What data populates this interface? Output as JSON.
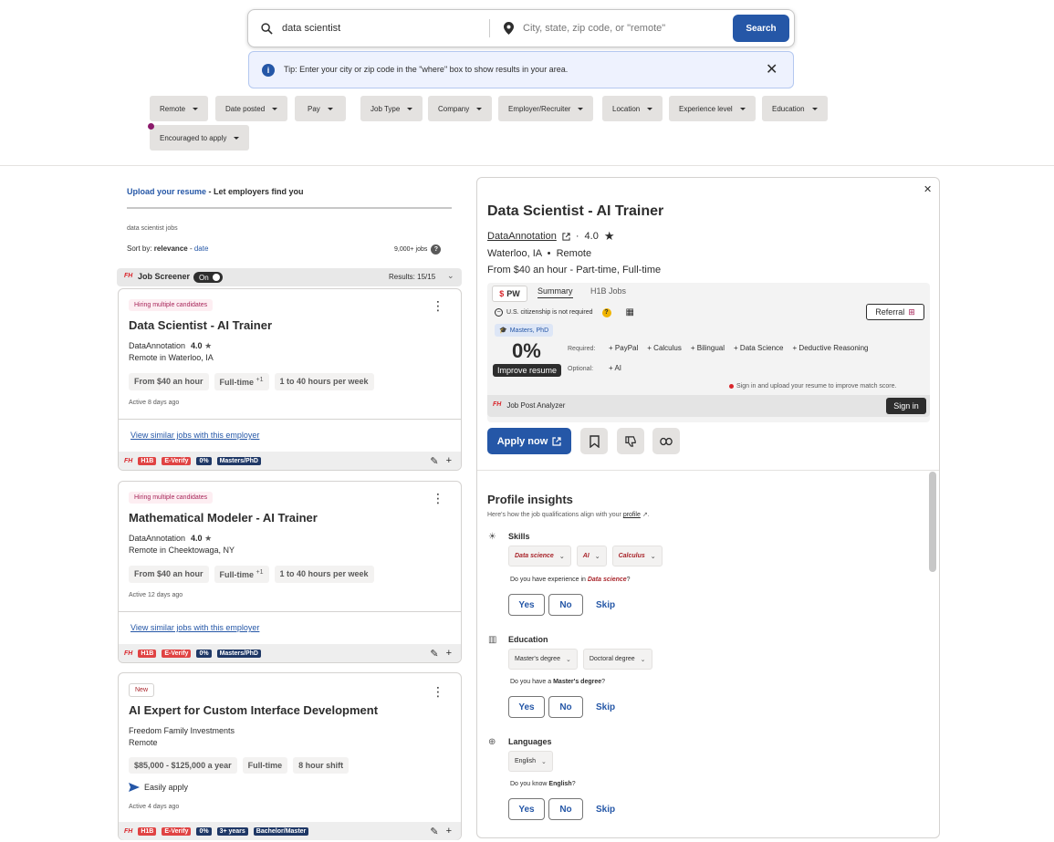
{
  "search": {
    "what_value": "data scientist",
    "where_placeholder": "City, state, zip code, or \"remote\"",
    "button_label": "Search"
  },
  "tip": {
    "text": "Tip: Enter your city or zip code in the \"where\" box to show results in your area."
  },
  "filters": [
    "Remote",
    "Date posted",
    "Pay",
    "Job Type",
    "Company",
    "Employer/Recruiter",
    "Location",
    "Experience level",
    "Education",
    "Encouraged to apply"
  ],
  "left": {
    "upload_link": "Upload your resume",
    "upload_rest": " - Let employers find you",
    "jobs_label": "data scientist jobs",
    "sort_prefix": "Sort by: ",
    "sort_active": "relevance",
    "sort_sep": " - ",
    "sort_other": "date",
    "count": "9,000+ jobs",
    "screener": {
      "fh": "FH",
      "label": "Job Screener",
      "toggle": "On",
      "results": "Results: 15/15"
    }
  },
  "cards": [
    {
      "badge": "Hiring multiple candidates",
      "title": "Data Scientist - AI Trainer",
      "company": "DataAnnotation",
      "rating": "4.0",
      "location": "Remote in Waterloo, IA",
      "chips": [
        "From $40 an hour",
        "Full-time",
        "1 to 40 hours per week"
      ],
      "chip_plus": "+1",
      "active": "Active 8 days ago",
      "similar": "View similar jobs with this employer",
      "tags": [
        "H1B",
        "E-Verify",
        "0%",
        "Masters/PhD"
      ]
    },
    {
      "badge": "Hiring multiple candidates",
      "title": "Mathematical Modeler - AI Trainer",
      "company": "DataAnnotation",
      "rating": "4.0",
      "location": "Remote in Cheektowaga, NY",
      "chips": [
        "From $40 an hour",
        "Full-time",
        "1 to 40 hours per week"
      ],
      "chip_plus": "+1",
      "active": "Active 12 days ago",
      "similar": "View similar jobs with this employer",
      "tags": [
        "H1B",
        "E-Verify",
        "0%",
        "Masters/PhD"
      ]
    },
    {
      "badge": "New",
      "title": "AI Expert for Custom Interface Development",
      "company": "Freedom Family Investments",
      "location": "Remote",
      "chips": [
        "$85,000 - $125,000 a year",
        "Full-time",
        "8 hour shift"
      ],
      "easy": "Easily apply",
      "active": "Active 4 days ago",
      "tags": [
        "H1B",
        "E-Verify",
        "0%",
        "3+ years",
        "Bachelor/Master"
      ]
    }
  ],
  "panel": {
    "title": "Data Scientist - AI Trainer",
    "company": "DataAnnotation",
    "rating": "4.0",
    "location": "Waterloo, IA",
    "remote": "Remote",
    "pay": "From $40 an hour",
    "job_type": " - Part-time, Full-time",
    "analyzer": {
      "pw": "PW",
      "tab_summary": "Summary",
      "tab_h1b": "H1B Jobs",
      "citizenship": "U.S. citizenship is not required",
      "referral": "Referral",
      "degree": "Masters, PhD",
      "score": "0%",
      "improve": "Improve resume",
      "required_label": "Required:",
      "required": [
        "PayPal",
        "Calculus",
        "Bilingual",
        "Data Science",
        "Deductive Reasoning"
      ],
      "optional_label": "Optional:",
      "optional": [
        "AI"
      ],
      "signin_note": "Sign in and upload your resume to improve match score.",
      "footer_fh": "FH",
      "footer_label": "Job Post Analyzer",
      "signin": "Sign in"
    },
    "apply": "Apply now",
    "insights": {
      "title": "Profile insights",
      "sub_prefix": "Here's how the job qualifications align with your ",
      "sub_link": "profile",
      "sub_suffix": ".",
      "skills": {
        "title": "Skills",
        "pills": [
          "Data science",
          "AI",
          "Calculus"
        ],
        "q_prefix": "Do you have experience in ",
        "q_item": "Data science",
        "q_suffix": "?"
      },
      "education": {
        "title": "Education",
        "pills": [
          "Master's degree",
          "Doctoral degree"
        ],
        "q_prefix": "Do you have a ",
        "q_item": "Master's degree",
        "q_suffix": "?"
      },
      "languages": {
        "title": "Languages",
        "pills": [
          "English"
        ],
        "q_prefix": "Do you know ",
        "q_item": "English",
        "q_suffix": "?"
      },
      "yes": "Yes",
      "no": "No",
      "skip": "Skip"
    }
  }
}
